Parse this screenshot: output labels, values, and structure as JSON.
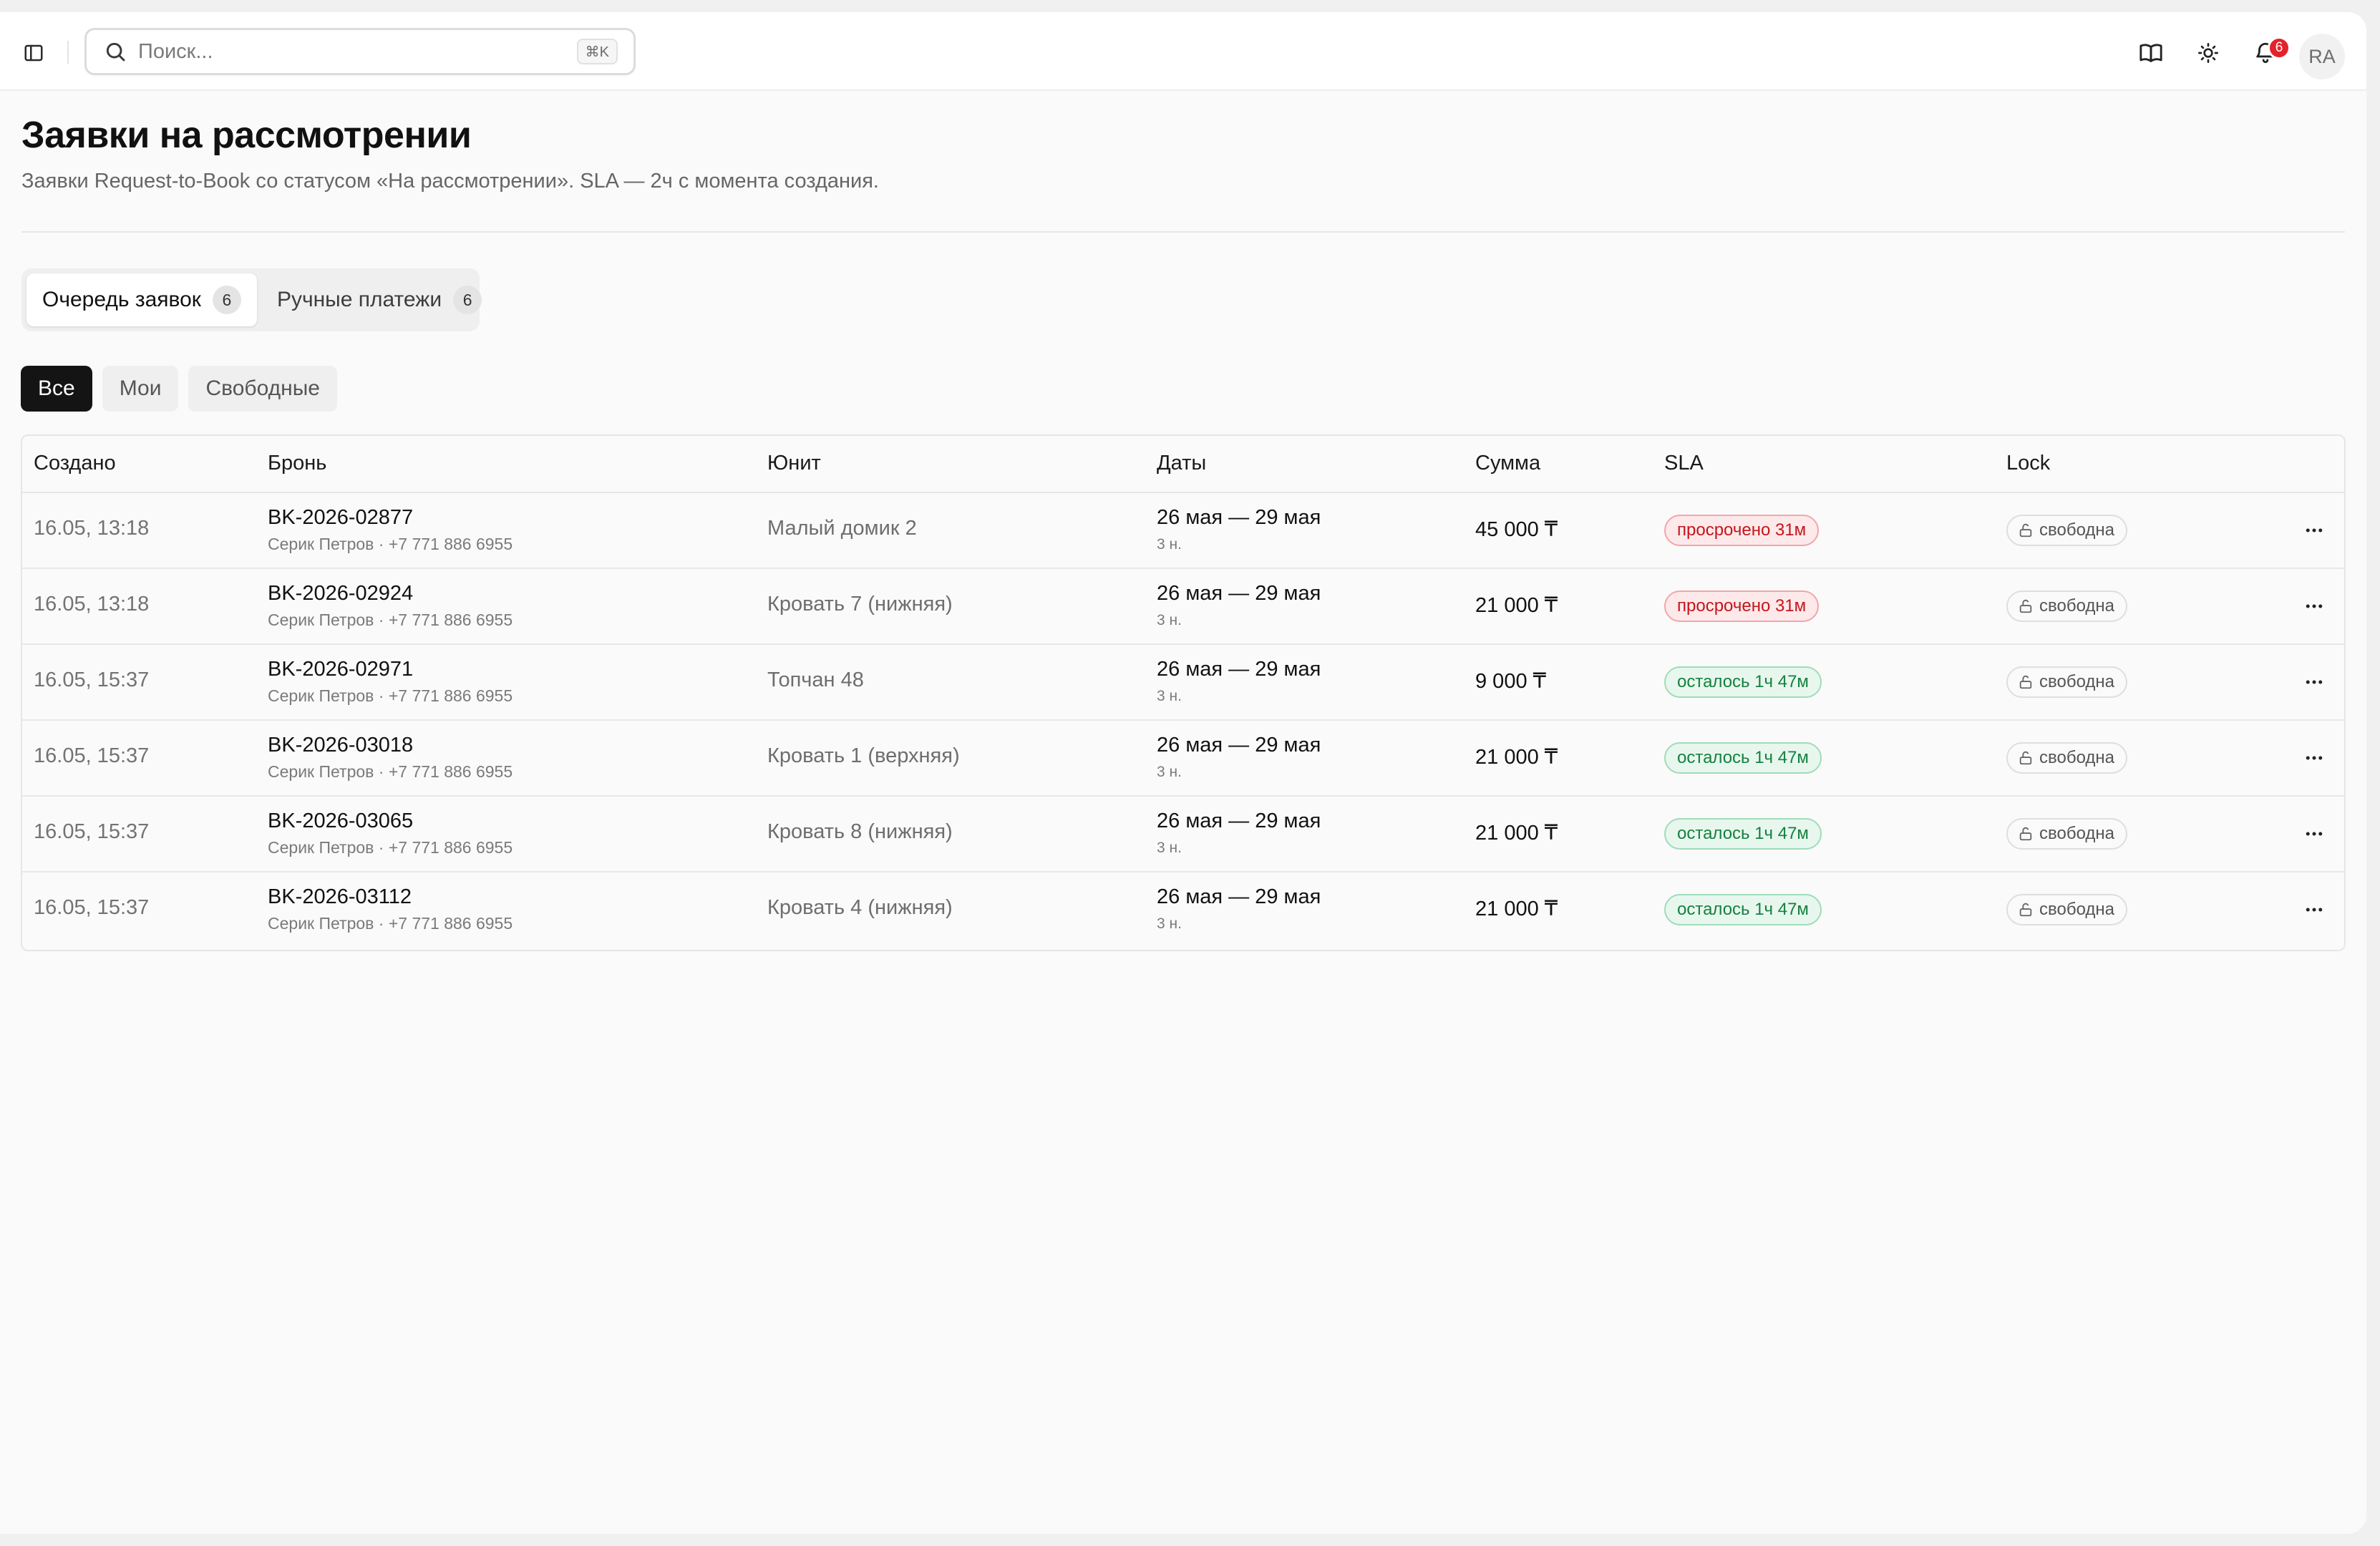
{
  "search": {
    "placeholder": "Поиск...",
    "shortcut": "⌘K"
  },
  "header": {
    "notification_count": "6",
    "avatar_initials": "RA"
  },
  "page": {
    "title": "Заявки на рассмотрении",
    "subtitle": "Заявки Request-to-Book со статусом «На рассмотрении». SLA — 2ч с момента создания."
  },
  "tabs": [
    {
      "label": "Очередь заявок",
      "count": "6"
    },
    {
      "label": "Ручные платежи",
      "count": "6"
    }
  ],
  "filters": [
    "Все",
    "Мои",
    "Свободные"
  ],
  "table": {
    "columns": [
      "Создано",
      "Бронь",
      "Юнит",
      "Даты",
      "Сумма",
      "SLA",
      "Lock"
    ],
    "rows": [
      {
        "created": "16.05, 13:18",
        "booking": "BK-2026-02877",
        "guest": "Серик Петров · +7 771 886 6955",
        "unit": "Малый домик 2",
        "dates": "26 мая — 29 мая",
        "nights": "3 н.",
        "sum": "45 000 ₸",
        "sla": "просрочено 31м",
        "sla_status": "overdue",
        "lock": "свободна"
      },
      {
        "created": "16.05, 13:18",
        "booking": "BK-2026-02924",
        "guest": "Серик Петров · +7 771 886 6955",
        "unit": "Кровать 7 (нижняя)",
        "dates": "26 мая — 29 мая",
        "nights": "3 н.",
        "sum": "21 000 ₸",
        "sla": "просрочено 31м",
        "sla_status": "overdue",
        "lock": "свободна"
      },
      {
        "created": "16.05, 15:37",
        "booking": "BK-2026-02971",
        "guest": "Серик Петров · +7 771 886 6955",
        "unit": "Топчан 48",
        "dates": "26 мая — 29 мая",
        "nights": "3 н.",
        "sum": "9 000 ₸",
        "sla": "осталось 1ч 47м",
        "sla_status": "ok",
        "lock": "свободна"
      },
      {
        "created": "16.05, 15:37",
        "booking": "BK-2026-03018",
        "guest": "Серик Петров · +7 771 886 6955",
        "unit": "Кровать 1 (верхняя)",
        "dates": "26 мая — 29 мая",
        "nights": "3 н.",
        "sum": "21 000 ₸",
        "sla": "осталось 1ч 47м",
        "sla_status": "ok",
        "lock": "свободна"
      },
      {
        "created": "16.05, 15:37",
        "booking": "BK-2026-03065",
        "guest": "Серик Петров · +7 771 886 6955",
        "unit": "Кровать 8 (нижняя)",
        "dates": "26 мая — 29 мая",
        "nights": "3 н.",
        "sum": "21 000 ₸",
        "sla": "осталось 1ч 47м",
        "sla_status": "ok",
        "lock": "свободна"
      },
      {
        "created": "16.05, 15:37",
        "booking": "BK-2026-03112",
        "guest": "Серик Петров · +7 771 886 6955",
        "unit": "Кровать 4 (нижняя)",
        "dates": "26 мая — 29 мая",
        "nights": "3 н.",
        "sum": "21 000 ₸",
        "sla": "осталось 1ч 47м",
        "sla_status": "ok",
        "lock": "свободна"
      }
    ]
  },
  "colors": {
    "accent": "#141414",
    "overdue": "#c4161c",
    "ok": "#16803f",
    "badge": "#e5212b"
  },
  "icons": {
    "sidebar": "sidebar-toggle-icon",
    "search": "search-icon",
    "docs": "book-icon",
    "theme": "sun-icon",
    "notifications": "bell-icon",
    "lock": "lock-open-icon",
    "more": "more-horizontal-icon"
  }
}
